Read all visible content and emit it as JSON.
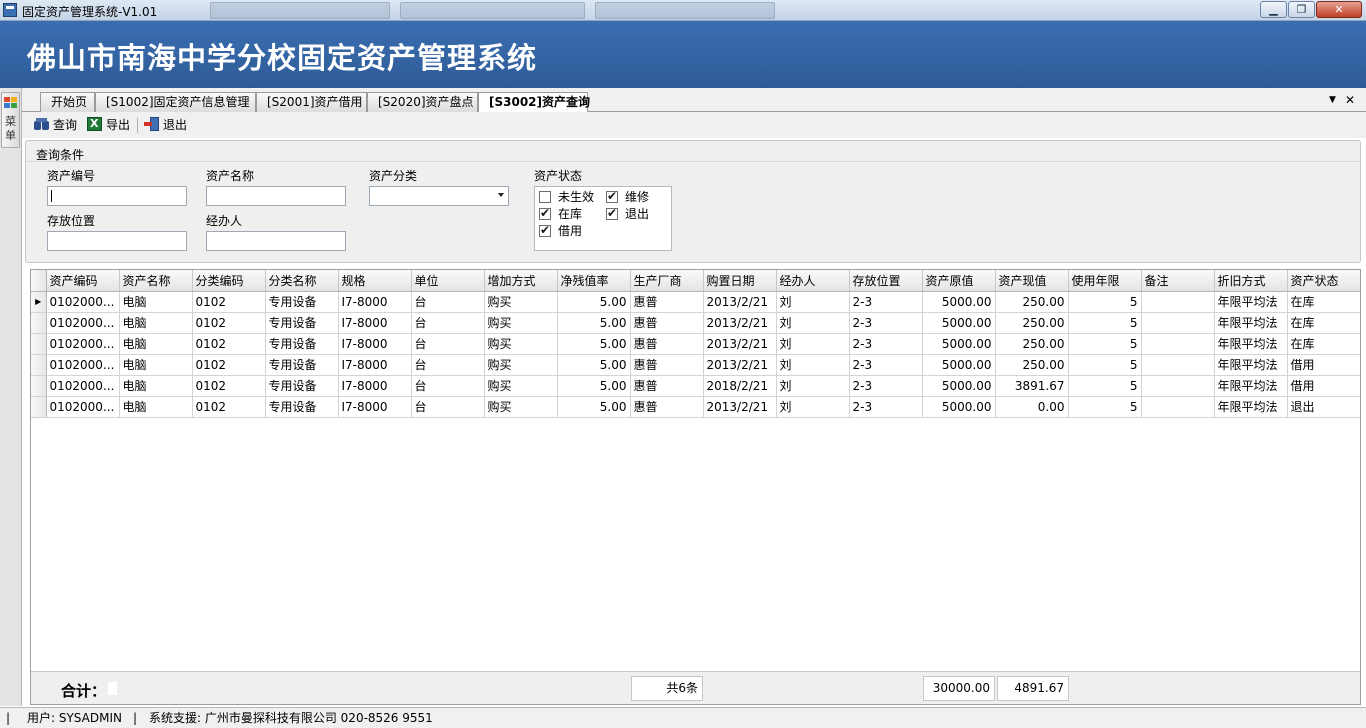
{
  "window": {
    "title": "固定资产管理系统-V1.01",
    "min": "▁",
    "max": "❐",
    "close": "✕"
  },
  "banner": {
    "title": "佛山市南海中学分校固定资产管理系统"
  },
  "leftmenu": {
    "label": "菜单"
  },
  "tabs": [
    {
      "label": "开始页"
    },
    {
      "label": "[S1002]固定资产信息管理"
    },
    {
      "label": "[S2001]资产借用"
    },
    {
      "label": "[S2020]资产盘点"
    },
    {
      "label": "[S3002]资产查询"
    }
  ],
  "tabctl": {
    "dropdown": "▼",
    "close": "✕"
  },
  "toolbar": {
    "query": "查询",
    "export": "导出",
    "exit": "退出"
  },
  "query": {
    "title": "查询条件",
    "asset_code_label": "资产编号",
    "asset_code_value": "",
    "asset_name_label": "资产名称",
    "asset_name_value": "",
    "category_label": "资产分类",
    "category_value": "",
    "location_label": "存放位置",
    "location_value": "",
    "handler_label": "经办人",
    "handler_value": "",
    "status_label": "资产状态",
    "status_options": [
      {
        "label": "未生效",
        "checked": false
      },
      {
        "label": "维修",
        "checked": true
      },
      {
        "label": "在库",
        "checked": true
      },
      {
        "label": "退出",
        "checked": true
      },
      {
        "label": "借用",
        "checked": true
      }
    ]
  },
  "grid": {
    "columns": [
      "资产编码",
      "资产名称",
      "分类编码",
      "分类名称",
      "规格",
      "单位",
      "增加方式",
      "净残值率",
      "生产厂商",
      "购置日期",
      "经办人",
      "存放位置",
      "资产原值",
      "资产现值",
      "使用年限",
      "备注",
      "折旧方式",
      "资产状态"
    ],
    "current_row_marker": "▶",
    "rows": [
      [
        "0102000...",
        "电脑",
        "0102",
        "专用设备",
        "I7-8000",
        "台",
        "购买",
        "5.00",
        "惠普",
        "2013/2/21",
        "刘",
        "2-3",
        "5000.00",
        "250.00",
        "5",
        "",
        "年限平均法",
        "在库"
      ],
      [
        "0102000...",
        "电脑",
        "0102",
        "专用设备",
        "I7-8000",
        "台",
        "购买",
        "5.00",
        "惠普",
        "2013/2/21",
        "刘",
        "2-3",
        "5000.00",
        "250.00",
        "5",
        "",
        "年限平均法",
        "在库"
      ],
      [
        "0102000...",
        "电脑",
        "0102",
        "专用设备",
        "I7-8000",
        "台",
        "购买",
        "5.00",
        "惠普",
        "2013/2/21",
        "刘",
        "2-3",
        "5000.00",
        "250.00",
        "5",
        "",
        "年限平均法",
        "在库"
      ],
      [
        "0102000...",
        "电脑",
        "0102",
        "专用设备",
        "I7-8000",
        "台",
        "购买",
        "5.00",
        "惠普",
        "2013/2/21",
        "刘",
        "2-3",
        "5000.00",
        "250.00",
        "5",
        "",
        "年限平均法",
        "借用"
      ],
      [
        "0102000...",
        "电脑",
        "0102",
        "专用设备",
        "I7-8000",
        "台",
        "购买",
        "5.00",
        "惠普",
        "2018/2/21",
        "刘",
        "2-3",
        "5000.00",
        "3891.67",
        "5",
        "",
        "年限平均法",
        "借用"
      ],
      [
        "0102000...",
        "电脑",
        "0102",
        "专用设备",
        "I7-8000",
        "台",
        "购买",
        "5.00",
        "惠普",
        "2013/2/21",
        "刘",
        "2-3",
        "5000.00",
        "0.00",
        "5",
        "",
        "年限平均法",
        "退出"
      ]
    ]
  },
  "footer": {
    "sum_label": "合计：",
    "count": "共6条",
    "original_total": "30000.00",
    "current_total": "4891.67"
  },
  "statusbar": {
    "user": "用户: SYSADMIN",
    "support": "系统支援: 广州市曼探科技有限公司 020-8526 9551"
  }
}
